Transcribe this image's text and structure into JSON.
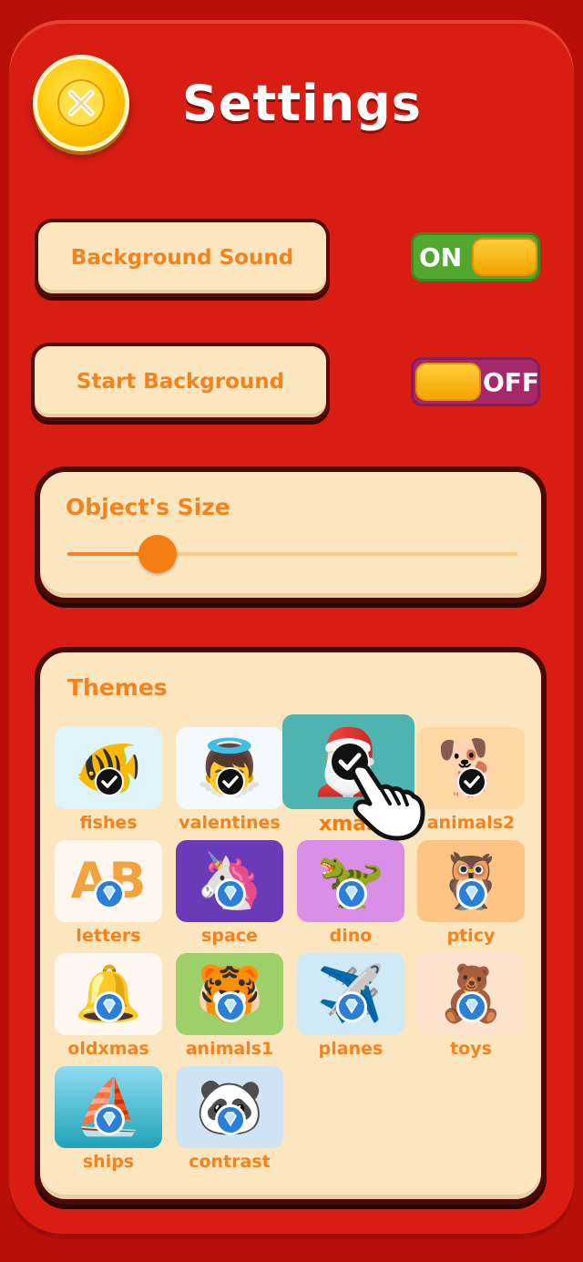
{
  "header": {
    "title": "Settings",
    "close_icon": "close-x-icon"
  },
  "settings": {
    "background_sound": {
      "label": "Background Sound",
      "toggle_text": "ON",
      "state": "on"
    },
    "start_background": {
      "label": "Start Background",
      "toggle_text": "OFF",
      "state": "off"
    }
  },
  "object_size": {
    "label": "Object's Size",
    "value_fraction": 0.2
  },
  "themes": {
    "label": "Themes",
    "items": [
      {
        "name": "fishes",
        "status": "selected"
      },
      {
        "name": "valentines",
        "status": "selected"
      },
      {
        "name": "xmas",
        "status": "selected"
      },
      {
        "name": "animals2",
        "status": "selected"
      },
      {
        "name": "letters",
        "status": "locked"
      },
      {
        "name": "space",
        "status": "locked"
      },
      {
        "name": "dino",
        "status": "locked"
      },
      {
        "name": "pticy",
        "status": "locked"
      },
      {
        "name": "oldxmas",
        "status": "locked"
      },
      {
        "name": "animals1",
        "status": "locked"
      },
      {
        "name": "planes",
        "status": "locked"
      },
      {
        "name": "toys",
        "status": "locked"
      },
      {
        "name": "ships",
        "status": "locked"
      },
      {
        "name": "contrast",
        "status": "locked"
      }
    ]
  },
  "colors": {
    "background": "#d81e12",
    "card": "#fbe6c0",
    "accent_text": "#f2831e",
    "toggle_on": "#52a72e",
    "toggle_off": "#a6276a",
    "knob": "#ffc400"
  }
}
